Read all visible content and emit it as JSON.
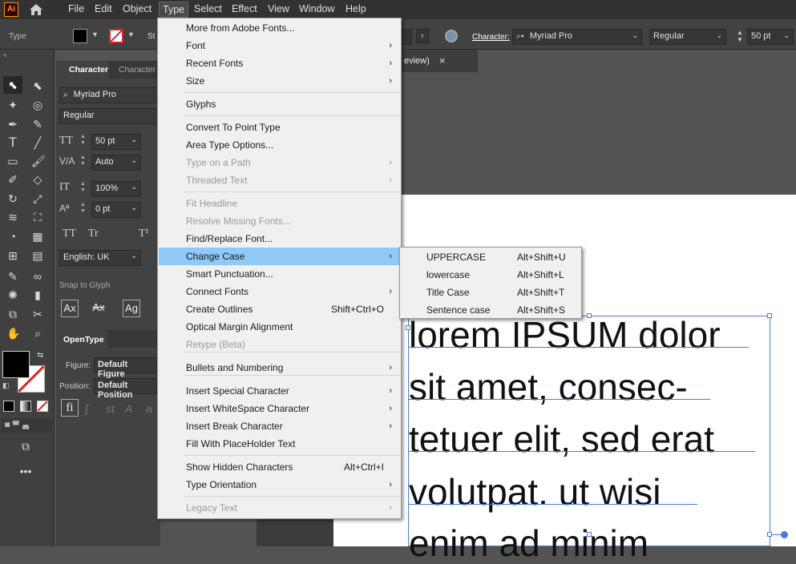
{
  "app": {
    "logo": "Ai",
    "home_icon": "home-icon"
  },
  "menubar": {
    "items": [
      "File",
      "Edit",
      "Object",
      "Type",
      "Select",
      "Effect",
      "View",
      "Window",
      "Help"
    ]
  },
  "control_bar": {
    "label": "Type",
    "stroke_label": "St",
    "character_label": "Character:",
    "font_family": "Myriad Pro",
    "font_style": "Regular",
    "font_size": "50 pt"
  },
  "doc_tab": {
    "title": "eview)",
    "close": "×"
  },
  "character_panel": {
    "tabs": [
      "Character",
      "Character"
    ],
    "font_family": "Myriad Pro",
    "font_style": "Regular",
    "font_size": "50 pt",
    "leading": "Auto",
    "vertical_scale": "100%",
    "tracking": "0 pt",
    "tt_labels": [
      "TT",
      "Tr",
      "T¹"
    ],
    "language": "English: UK",
    "snap_to_glyph": "Snap to Glyph",
    "glyph_buttons": [
      "Ax",
      "Ax",
      "Ag"
    ],
    "opentype_tab": "OpenType",
    "figure_label": "Figure:",
    "figure_value": "Default Figure",
    "position_label": "Position:",
    "position_value": "Default Position",
    "fi_label": "fi"
  },
  "type_menu": {
    "items": [
      {
        "label": "More from Adobe Fonts...",
        "disabled": false
      },
      {
        "label": "Font",
        "arrow": "›"
      },
      {
        "label": "Recent Fonts",
        "arrow": "›"
      },
      {
        "label": "Size",
        "arrow": "›"
      },
      {
        "label": "Glyphs"
      },
      {
        "label": "Convert To Point Type"
      },
      {
        "label": "Area Type Options..."
      },
      {
        "label": "Type on a Path",
        "arrow": "›",
        "disabled": true
      },
      {
        "label": "Threaded Text",
        "arrow": "›",
        "disabled": true
      },
      {
        "label": "Fit Headline",
        "disabled": true
      },
      {
        "label": "Resolve Missing Fonts...",
        "disabled": true
      },
      {
        "label": "Find/Replace Font..."
      },
      {
        "label": "Change Case",
        "arrow": "›",
        "highlighted": true
      },
      {
        "label": "Smart Punctuation..."
      },
      {
        "label": "Connect Fonts",
        "arrow": "›"
      },
      {
        "label": "Create Outlines",
        "shortcut": "Shift+Ctrl+O"
      },
      {
        "label": "Optical Margin Alignment"
      },
      {
        "label": "Retype (Beta)",
        "disabled": true
      },
      {
        "label": "Bullets and Numbering",
        "arrow": "›"
      },
      {
        "label": "Insert Special Character",
        "arrow": "›"
      },
      {
        "label": "Insert WhiteSpace Character",
        "arrow": "›"
      },
      {
        "label": "Insert Break Character",
        "arrow": "›"
      },
      {
        "label": "Fill With PlaceHolder Text"
      },
      {
        "label": "Show Hidden Characters",
        "shortcut": "Alt+Ctrl+I"
      },
      {
        "label": "Type Orientation",
        "arrow": "›"
      },
      {
        "label": "Legacy Text",
        "arrow": "›",
        "disabled": true
      }
    ]
  },
  "change_case_submenu": {
    "items": [
      {
        "label": "UPPERCASE",
        "shortcut": "Alt+Shift+U"
      },
      {
        "label": "lowercase",
        "shortcut": "Alt+Shift+L"
      },
      {
        "label": "Title Case",
        "shortcut": "Alt+Shift+T"
      },
      {
        "label": "Sentence case",
        "shortcut": "Alt+Shift+S"
      }
    ]
  },
  "canvas_text": {
    "lines": [
      "lorem IPSUM dolor",
      "sit amet, consec-",
      "tetuer  elit, sed erat",
      "volutpat. ut wisi",
      "enim ad minim"
    ]
  },
  "colors": {
    "highlight": "#90c8f6",
    "selection": "#4a7bd8",
    "logo_bg": "#330000",
    "logo_fg": "#ff9a00"
  }
}
